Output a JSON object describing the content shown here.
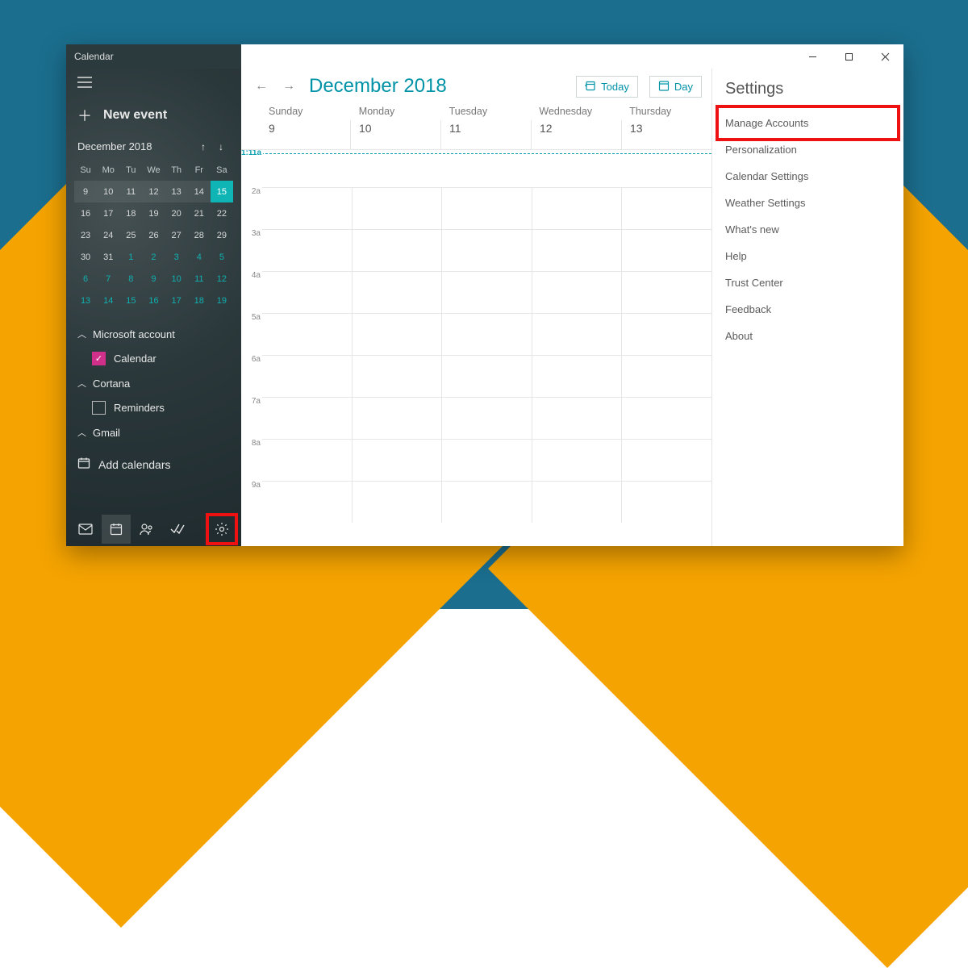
{
  "window": {
    "title": "Calendar"
  },
  "sidebar": {
    "new_event": "New event",
    "month_label": "December 2018",
    "dow": [
      "Su",
      "Mo",
      "Tu",
      "We",
      "Th",
      "Fr",
      "Sa"
    ],
    "weeks": [
      [
        {
          "n": "9"
        },
        {
          "n": "10"
        },
        {
          "n": "11"
        },
        {
          "n": "12"
        },
        {
          "n": "13"
        },
        {
          "n": "14"
        },
        {
          "n": "15",
          "today": true
        }
      ],
      [
        {
          "n": "16"
        },
        {
          "n": "17"
        },
        {
          "n": "18"
        },
        {
          "n": "19"
        },
        {
          "n": "20"
        },
        {
          "n": "21"
        },
        {
          "n": "22"
        }
      ],
      [
        {
          "n": "23"
        },
        {
          "n": "24"
        },
        {
          "n": "25"
        },
        {
          "n": "26"
        },
        {
          "n": "27"
        },
        {
          "n": "28"
        },
        {
          "n": "29"
        }
      ],
      [
        {
          "n": "30"
        },
        {
          "n": "31"
        },
        {
          "n": "1",
          "next": true
        },
        {
          "n": "2",
          "next": true
        },
        {
          "n": "3",
          "next": true
        },
        {
          "n": "4",
          "next": true
        },
        {
          "n": "5",
          "next": true
        }
      ],
      [
        {
          "n": "6",
          "next": true
        },
        {
          "n": "7",
          "next": true
        },
        {
          "n": "8",
          "next": true
        },
        {
          "n": "9",
          "next": true
        },
        {
          "n": "10",
          "next": true
        },
        {
          "n": "11",
          "next": true
        },
        {
          "n": "12",
          "next": true
        }
      ],
      [
        {
          "n": "13",
          "next": true
        },
        {
          "n": "14",
          "next": true
        },
        {
          "n": "15",
          "next": true
        },
        {
          "n": "16",
          "next": true
        },
        {
          "n": "17",
          "next": true
        },
        {
          "n": "18",
          "next": true
        },
        {
          "n": "19",
          "next": true
        }
      ]
    ],
    "accounts": [
      {
        "name": "Microsoft account",
        "items": [
          {
            "label": "Calendar",
            "checked": true
          }
        ]
      },
      {
        "name": "Cortana",
        "items": [
          {
            "label": "Reminders",
            "checked": false
          }
        ]
      },
      {
        "name": "Gmail",
        "items": []
      }
    ],
    "add_calendars": "Add calendars"
  },
  "calendar": {
    "title": "December 2018",
    "today_label": "Today",
    "view_label": "Day",
    "day_names": [
      "Sunday",
      "Monday",
      "Tuesday",
      "Wednesday",
      "Thursday"
    ],
    "dates": [
      "9",
      "10",
      "11",
      "12",
      "13"
    ],
    "now_label": "1:11a",
    "hours": [
      "2a",
      "3a",
      "4a",
      "5a",
      "6a",
      "7a",
      "8a",
      "9a"
    ]
  },
  "settings": {
    "title": "Settings",
    "items": [
      {
        "label": "Manage Accounts",
        "highlight": true
      },
      {
        "label": "Personalization"
      },
      {
        "label": "Calendar Settings"
      },
      {
        "label": "Weather Settings"
      },
      {
        "label": "What's new"
      },
      {
        "label": "Help"
      },
      {
        "label": "Trust Center"
      },
      {
        "label": "Feedback"
      },
      {
        "label": "About"
      }
    ]
  }
}
